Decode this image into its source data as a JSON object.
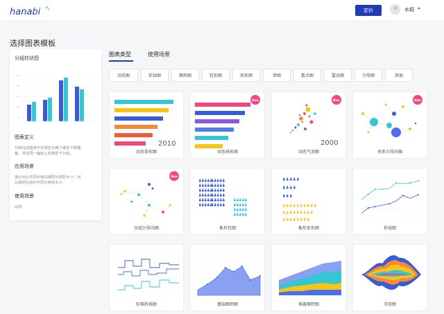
{
  "header": {
    "logo_text": "hanabi",
    "pricing_button": "定价",
    "user_name": "水韬"
  },
  "page_title": "选择图表模板",
  "sidebar": {
    "chart_title": "分组柱状图",
    "section_definition": "图表定义",
    "definition_text_1": "分组柱状图用于并排显示两个或多个数据",
    "definition_text_2": "集，并在同一轴线上的类别下分组。",
    "section_scenario": "应用场景",
    "scenario_text_1": "适合对比不同分组内相同分类的大小、对",
    "scenario_text_2": "比相同分组内不同分类的大小",
    "section_usage": "使用场景",
    "usage_text": "比较"
  },
  "tabs": [
    {
      "label": "图表类型",
      "active": true
    },
    {
      "label": "使用场景",
      "active": false
    }
  ],
  "filters": [
    "动态图",
    "折线图",
    "面积图",
    "柱形图",
    "条形图",
    "饼图",
    "散点图",
    "雷达图",
    "力导图",
    "其他"
  ],
  "cards": [
    {
      "caption": "动态条形图",
      "is_new": false,
      "overlay": "2010"
    },
    {
      "caption": "动态排名图",
      "is_new": true,
      "overlay": ""
    },
    {
      "caption": "动态气泡图",
      "is_new": true,
      "overlay": "2000"
    },
    {
      "caption": "关系力导向图",
      "is_new": true,
      "overlay": ""
    },
    {
      "caption": "分组力导向图",
      "is_new": true,
      "overlay": ""
    },
    {
      "caption": "象形柱图",
      "is_new": false,
      "overlay": ""
    },
    {
      "caption": "象形条形图",
      "is_new": false,
      "overlay": ""
    },
    {
      "caption": "折线图",
      "is_new": false,
      "overlay": ""
    },
    {
      "caption": "阶梯折线图",
      "is_new": false,
      "overlay": ""
    },
    {
      "caption": "基础面积图",
      "is_new": false,
      "overlay": ""
    },
    {
      "caption": "堆叠面积图",
      "is_new": false,
      "overlay": ""
    },
    {
      "caption": "河流图",
      "is_new": false,
      "overlay": ""
    }
  ],
  "badge_text": "New",
  "colors": {
    "brand": "#1e3bb8",
    "new_badge": "#f1487f",
    "primary_blue": "#3a5bd9",
    "teal": "#36c6d3"
  }
}
